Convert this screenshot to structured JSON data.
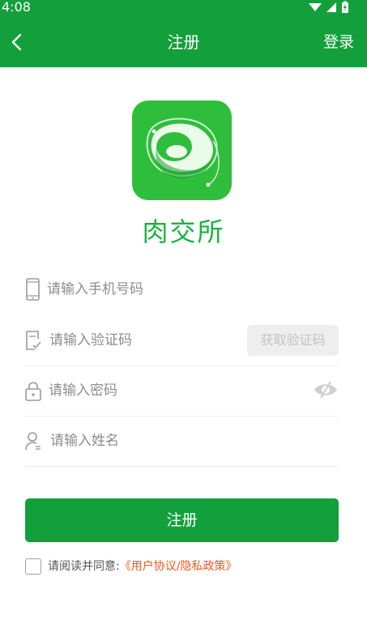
{
  "status_bar": {
    "time": "4:08"
  },
  "app_bar": {
    "title": "注册",
    "right_action": "登录"
  },
  "brand": {
    "app_name": "肉交所"
  },
  "form": {
    "phone": {
      "placeholder": "请输入手机号码",
      "value": ""
    },
    "code": {
      "placeholder": "请输入验证码",
      "value": "",
      "get_code_label": "获取验证码"
    },
    "password": {
      "placeholder": "请输入密码",
      "value": ""
    },
    "name": {
      "placeholder": "请输入姓名",
      "value": ""
    },
    "submit_label": "注册"
  },
  "agreement": {
    "checked": false,
    "prefix": "请阅读并同意:",
    "link": "《用户协议/隐私政策》"
  },
  "colors": {
    "primary": "#13a03c",
    "brand_text": "#18b43d",
    "link": "#f05a1a",
    "placeholder": "#8d8d8d"
  }
}
